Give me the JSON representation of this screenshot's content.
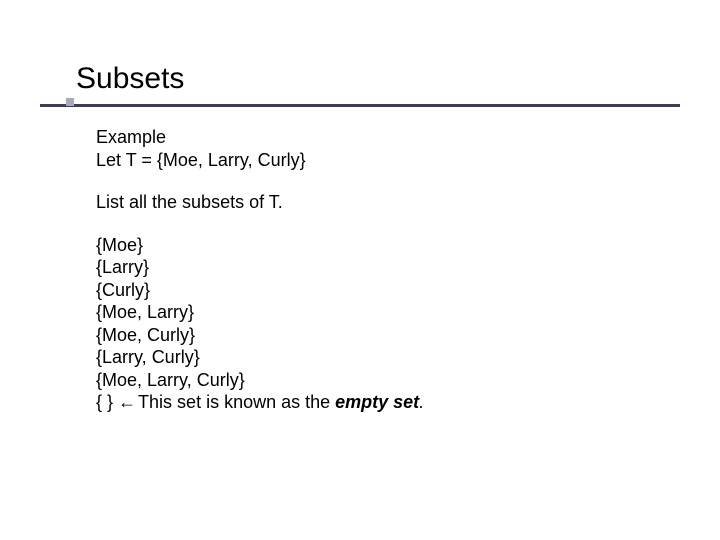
{
  "title": "Subsets",
  "intro": {
    "line1": "Example",
    "line2": "Let T = {Moe, Larry, Curly}"
  },
  "prompt": "List all the subsets of T.",
  "subsets": {
    "s1": "{Moe}",
    "s2": "{Larry}",
    "s3": "{Curly}",
    "s4": "{Moe, Larry}",
    "s5": "{Moe, Curly}",
    "s6": "{Larry, Curly}",
    "s7": "{Moe, Larry, Curly}"
  },
  "empty": {
    "set": "{ }",
    "arrow": "←",
    "note_prefix": "This set is known as the ",
    "note_em": "empty set",
    "period": "."
  }
}
